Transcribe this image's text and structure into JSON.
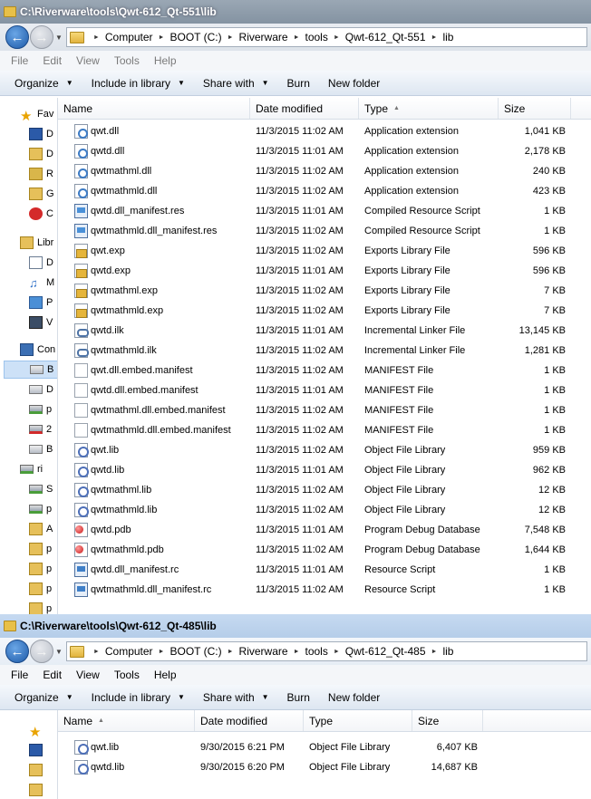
{
  "windows": [
    {
      "title": "C:\\Riverware\\tools\\Qwt-612_Qt-551\\lib",
      "breadcrumbs": [
        "Computer",
        "BOOT (C:)",
        "Riverware",
        "tools",
        "Qwt-612_Qt-551",
        "lib"
      ],
      "menu": [
        "File",
        "Edit",
        "View",
        "Tools",
        "Help"
      ],
      "commands": [
        {
          "label": "Organize",
          "dropdown": true
        },
        {
          "label": "Include in library",
          "dropdown": true
        },
        {
          "label": "Share with",
          "dropdown": true
        },
        {
          "label": "Burn",
          "dropdown": false
        },
        {
          "label": "New folder",
          "dropdown": false
        }
      ],
      "columns": [
        "Name",
        "Date modified",
        "Type",
        "Size"
      ],
      "sorted_column": "Type",
      "nav_items": [
        {
          "label": "Fav",
          "icon": "star-icon"
        },
        {
          "label": "D",
          "icon": "desktop-icon"
        },
        {
          "label": "D",
          "icon": "downloads-icon"
        },
        {
          "label": "R",
          "icon": "recent-icon"
        },
        {
          "label": "G",
          "icon": "folder-icon"
        },
        {
          "label": "C",
          "icon": "creative-cloud-icon"
        },
        {
          "label": "Libr",
          "icon": "library-icon"
        },
        {
          "label": "D",
          "icon": "documents-icon"
        },
        {
          "label": "M",
          "icon": "music-icon"
        },
        {
          "label": "P",
          "icon": "pictures-icon"
        },
        {
          "label": "V",
          "icon": "videos-icon"
        },
        {
          "label": "Con",
          "icon": "computer-icon"
        },
        {
          "label": "B",
          "icon": "drive-icon"
        },
        {
          "label": "D",
          "icon": "drive-icon"
        },
        {
          "label": "p",
          "icon": "network-drive-icon"
        },
        {
          "label": "2",
          "icon": "disconnected-drive-icon"
        },
        {
          "label": "B",
          "icon": "drive-icon"
        },
        {
          "label": "ri",
          "icon": "network-drive-icon"
        },
        {
          "label": "S",
          "icon": "network-drive-icon"
        },
        {
          "label": "p",
          "icon": "network-drive-icon"
        },
        {
          "label": "A",
          "icon": "folder-icon"
        },
        {
          "label": "p",
          "icon": "folder-icon"
        },
        {
          "label": "p",
          "icon": "folder-icon"
        },
        {
          "label": "p",
          "icon": "folder-icon"
        },
        {
          "label": "p",
          "icon": "folder-icon"
        },
        {
          "label": "p",
          "icon": "folder-icon"
        }
      ],
      "files": [
        {
          "name": "qwt.dll",
          "date": "11/3/2015 11:02 AM",
          "type": "Application extension",
          "size": "1,041 KB",
          "icon": "dll-icon"
        },
        {
          "name": "qwtd.dll",
          "date": "11/3/2015 11:01 AM",
          "type": "Application extension",
          "size": "2,178 KB",
          "icon": "dll-icon"
        },
        {
          "name": "qwtmathml.dll",
          "date": "11/3/2015 11:02 AM",
          "type": "Application extension",
          "size": "240 KB",
          "icon": "dll-icon"
        },
        {
          "name": "qwtmathmld.dll",
          "date": "11/3/2015 11:02 AM",
          "type": "Application extension",
          "size": "423 KB",
          "icon": "dll-icon"
        },
        {
          "name": "qwtd.dll_manifest.res",
          "date": "11/3/2015 11:01 AM",
          "type": "Compiled Resource Script",
          "size": "1 KB",
          "icon": "res-icon"
        },
        {
          "name": "qwtmathmld.dll_manifest.res",
          "date": "11/3/2015 11:02 AM",
          "type": "Compiled Resource Script",
          "size": "1 KB",
          "icon": "res-icon"
        },
        {
          "name": "qwt.exp",
          "date": "11/3/2015 11:02 AM",
          "type": "Exports Library File",
          "size": "596 KB",
          "icon": "exp-icon"
        },
        {
          "name": "qwtd.exp",
          "date": "11/3/2015 11:01 AM",
          "type": "Exports Library File",
          "size": "596 KB",
          "icon": "exp-icon"
        },
        {
          "name": "qwtmathml.exp",
          "date": "11/3/2015 11:02 AM",
          "type": "Exports Library File",
          "size": "7 KB",
          "icon": "exp-icon"
        },
        {
          "name": "qwtmathmld.exp",
          "date": "11/3/2015 11:02 AM",
          "type": "Exports Library File",
          "size": "7 KB",
          "icon": "exp-icon"
        },
        {
          "name": "qwtd.ilk",
          "date": "11/3/2015 11:01 AM",
          "type": "Incremental Linker File",
          "size": "13,145 KB",
          "icon": "ilk-icon"
        },
        {
          "name": "qwtmathmld.ilk",
          "date": "11/3/2015 11:02 AM",
          "type": "Incremental Linker File",
          "size": "1,281 KB",
          "icon": "ilk-icon"
        },
        {
          "name": "qwt.dll.embed.manifest",
          "date": "11/3/2015 11:02 AM",
          "type": "MANIFEST File",
          "size": "1 KB",
          "icon": "manifest-icon"
        },
        {
          "name": "qwtd.dll.embed.manifest",
          "date": "11/3/2015 11:01 AM",
          "type": "MANIFEST File",
          "size": "1 KB",
          "icon": "manifest-icon"
        },
        {
          "name": "qwtmathml.dll.embed.manifest",
          "date": "11/3/2015 11:02 AM",
          "type": "MANIFEST File",
          "size": "1 KB",
          "icon": "manifest-icon"
        },
        {
          "name": "qwtmathmld.dll.embed.manifest",
          "date": "11/3/2015 11:02 AM",
          "type": "MANIFEST File",
          "size": "1 KB",
          "icon": "manifest-icon"
        },
        {
          "name": "qwt.lib",
          "date": "11/3/2015 11:02 AM",
          "type": "Object File Library",
          "size": "959 KB",
          "icon": "lib-icon"
        },
        {
          "name": "qwtd.lib",
          "date": "11/3/2015 11:01 AM",
          "type": "Object File Library",
          "size": "962 KB",
          "icon": "lib-icon"
        },
        {
          "name": "qwtmathml.lib",
          "date": "11/3/2015 11:02 AM",
          "type": "Object File Library",
          "size": "12 KB",
          "icon": "lib-icon"
        },
        {
          "name": "qwtmathmld.lib",
          "date": "11/3/2015 11:02 AM",
          "type": "Object File Library",
          "size": "12 KB",
          "icon": "lib-icon"
        },
        {
          "name": "qwtd.pdb",
          "date": "11/3/2015 11:01 AM",
          "type": "Program Debug Database",
          "size": "7,548 KB",
          "icon": "pdb-icon"
        },
        {
          "name": "qwtmathmld.pdb",
          "date": "11/3/2015 11:02 AM",
          "type": "Program Debug Database",
          "size": "1,644 KB",
          "icon": "pdb-icon"
        },
        {
          "name": "qwtd.dll_manifest.rc",
          "date": "11/3/2015 11:01 AM",
          "type": "Resource Script",
          "size": "1 KB",
          "icon": "rc-icon"
        },
        {
          "name": "qwtmathmld.dll_manifest.rc",
          "date": "11/3/2015 11:02 AM",
          "type": "Resource Script",
          "size": "1 KB",
          "icon": "rc-icon"
        }
      ]
    },
    {
      "title": "C:\\Riverware\\tools\\Qwt-612_Qt-485\\lib",
      "breadcrumbs": [
        "Computer",
        "BOOT (C:)",
        "Riverware",
        "tools",
        "Qwt-612_Qt-485",
        "lib"
      ],
      "menu": [
        "File",
        "Edit",
        "View",
        "Tools",
        "Help"
      ],
      "commands": [
        {
          "label": "Organize",
          "dropdown": true
        },
        {
          "label": "Include in library",
          "dropdown": true
        },
        {
          "label": "Share with",
          "dropdown": true
        },
        {
          "label": "Burn",
          "dropdown": false
        },
        {
          "label": "New folder",
          "dropdown": false
        }
      ],
      "columns": [
        "Name",
        "Date modified",
        "Type",
        "Size"
      ],
      "sorted_column": "Name",
      "nav_items": [
        {
          "label": "",
          "icon": "star-icon"
        },
        {
          "label": "",
          "icon": "desktop-icon"
        },
        {
          "label": "",
          "icon": "downloads-icon"
        },
        {
          "label": "",
          "icon": "folder-icon"
        }
      ],
      "files": [
        {
          "name": "qwt.lib",
          "date": "9/30/2015 6:21 PM",
          "type": "Object File Library",
          "size": "6,407 KB",
          "icon": "lib-icon"
        },
        {
          "name": "qwtd.lib",
          "date": "9/30/2015 6:20 PM",
          "type": "Object File Library",
          "size": "14,687 KB",
          "icon": "lib-icon"
        }
      ]
    }
  ]
}
